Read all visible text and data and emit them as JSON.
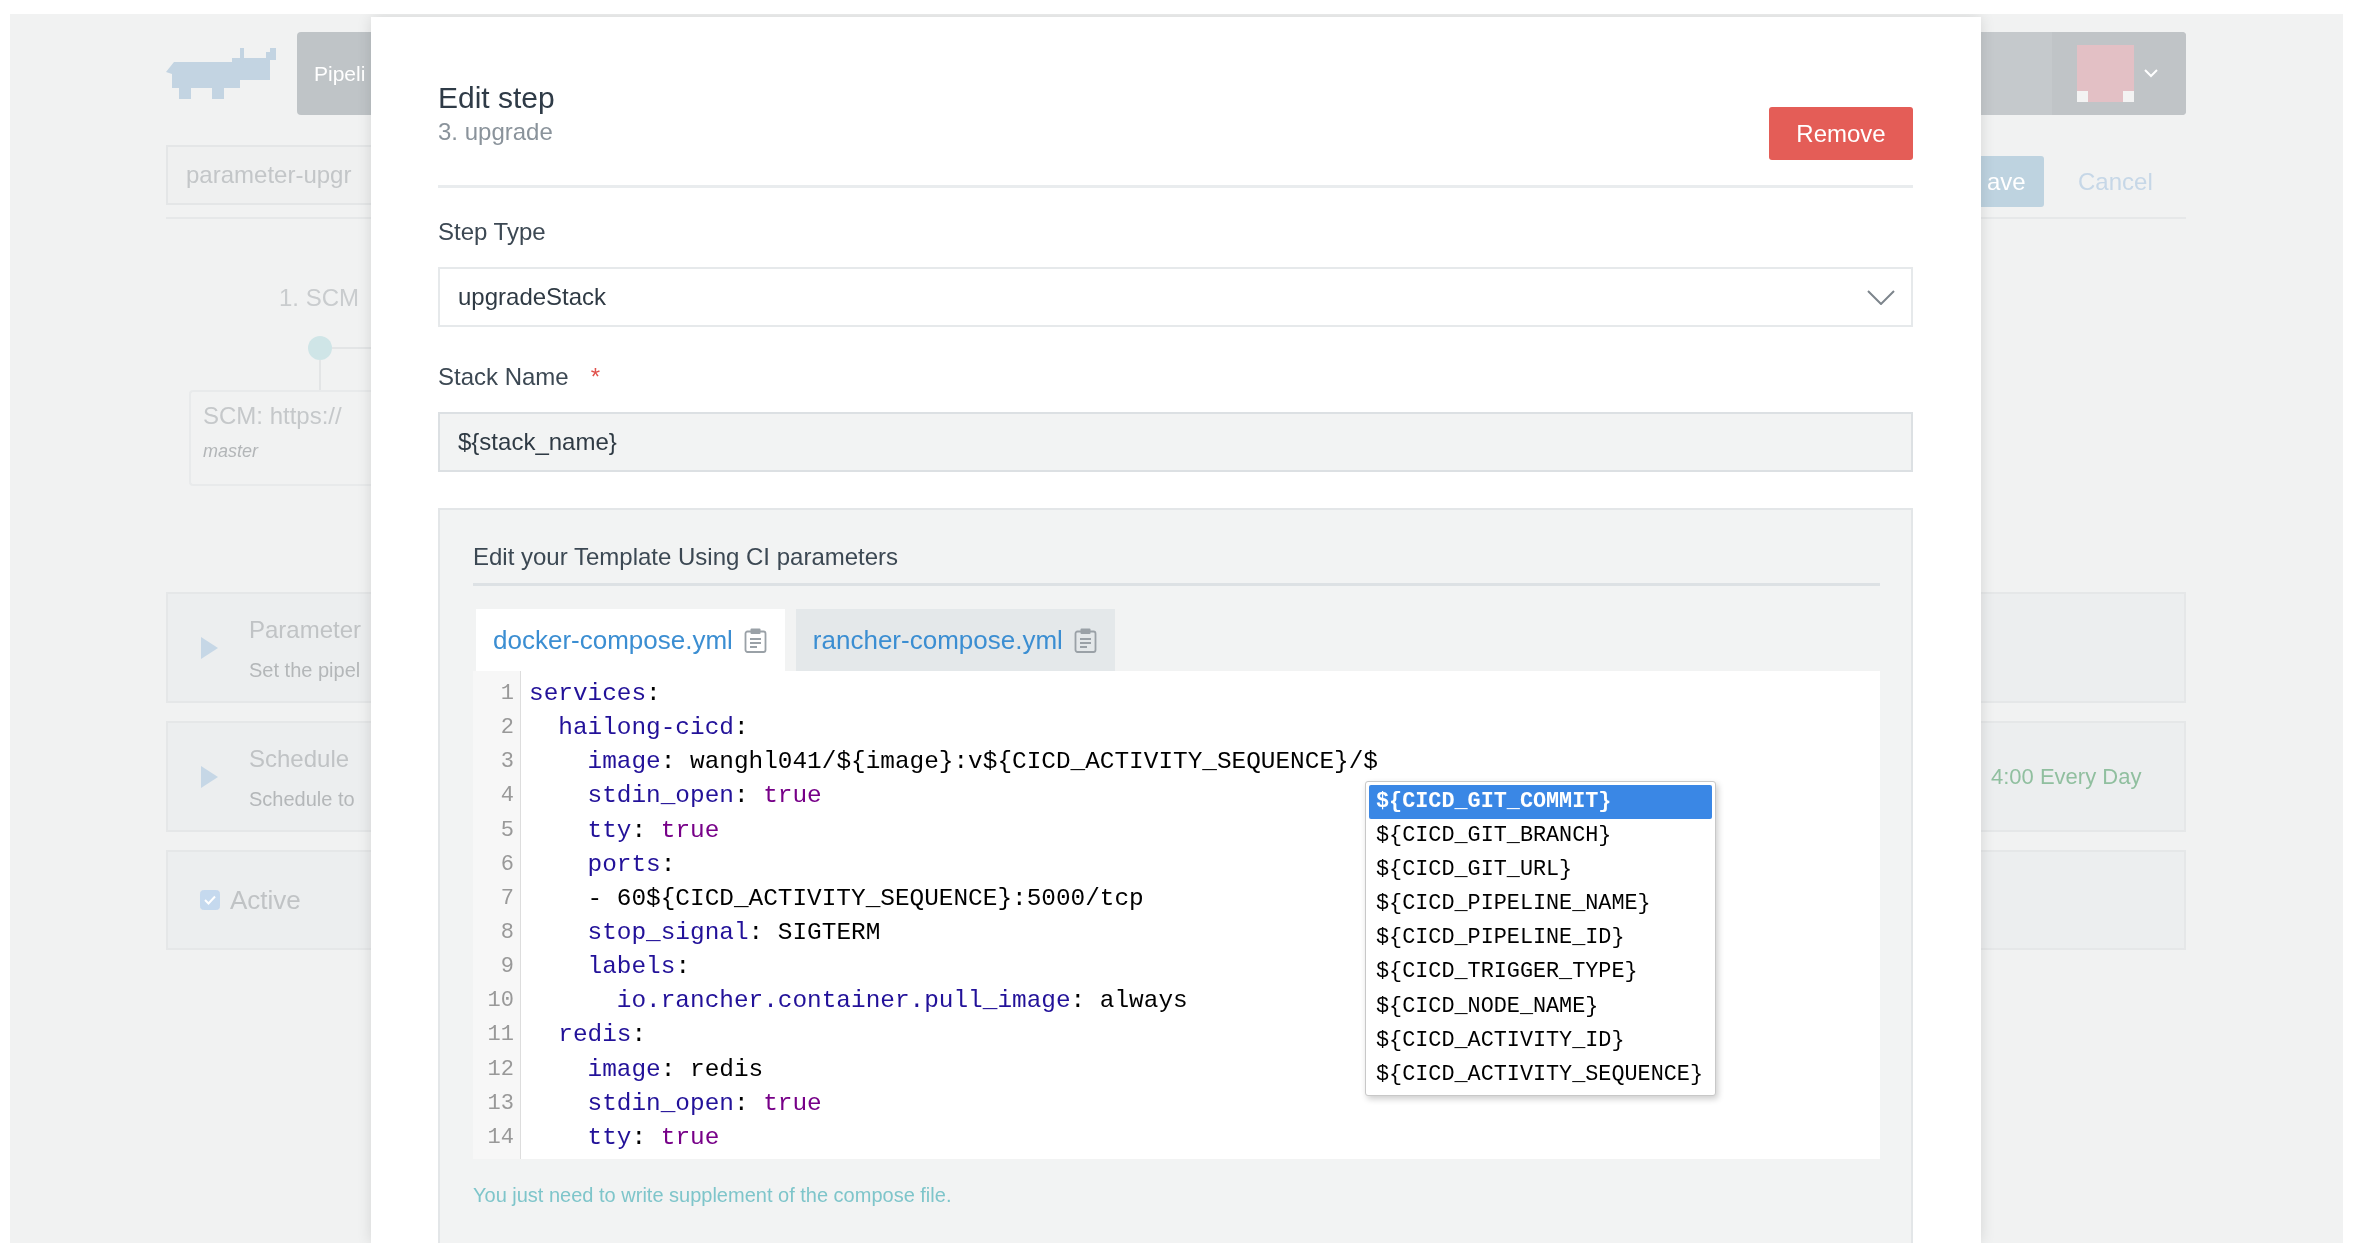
{
  "background": {
    "nav": {
      "tab": "Pipeli"
    },
    "pipeline_name": "parameter-upgr",
    "actions": [
      {
        "kind": "primary",
        "label": "ave"
      },
      {
        "kind": "link",
        "label": "Cancel"
      }
    ],
    "stage": {
      "title": "1. SCM",
      "card_title": "SCM: https://",
      "card_subtitle": "master"
    },
    "panels": [
      {
        "kind": "expander",
        "title": "Parameter",
        "description": "Set the pipel",
        "expanded": false
      },
      {
        "kind": "expander",
        "title": "Schedule",
        "description": "Schedule to",
        "summary": "4:00 Every Day",
        "expanded": false
      },
      {
        "kind": "checkbox",
        "label": "Active",
        "checked": true
      }
    ]
  },
  "modal": {
    "title": "Edit step",
    "subtitle": "3. upgrade",
    "remove_button": "Remove",
    "fields": [
      {
        "kind": "select",
        "label": "Step Type",
        "value": "upgradeStack"
      },
      {
        "kind": "input",
        "label": "Stack Name",
        "required_mark": "*",
        "value": "${stack_name}"
      }
    ],
    "template": {
      "title": "Edit your Template Using CI parameters",
      "tabs": [
        {
          "label": "docker-compose.yml",
          "selected": true
        },
        {
          "label": "rancher-compose.yml",
          "selected": false
        }
      ],
      "code_lines": [
        {
          "number": "1",
          "tokens": [
            {
              "kind": "key",
              "text": "services"
            },
            {
              "kind": "plain",
              "text": ":"
            }
          ]
        },
        {
          "number": "2",
          "tokens": [
            {
              "kind": "key",
              "text": "  hailong-cicd"
            },
            {
              "kind": "plain",
              "text": ":"
            }
          ]
        },
        {
          "number": "3",
          "tokens": [
            {
              "kind": "key",
              "text": "    image"
            },
            {
              "kind": "plain",
              "text": ": wanghl041/${image}:v${CICD_ACTIVITY_SEQUENCE}/$"
            }
          ]
        },
        {
          "number": "4",
          "tokens": [
            {
              "kind": "key",
              "text": "    stdin_open"
            },
            {
              "kind": "plain",
              "text": ": "
            },
            {
              "kind": "keyword",
              "text": "true"
            }
          ]
        },
        {
          "number": "5",
          "tokens": [
            {
              "kind": "key",
              "text": "    tty"
            },
            {
              "kind": "plain",
              "text": ": "
            },
            {
              "kind": "keyword",
              "text": "true"
            }
          ]
        },
        {
          "number": "6",
          "tokens": [
            {
              "kind": "key",
              "text": "    ports"
            },
            {
              "kind": "plain",
              "text": ":"
            }
          ]
        },
        {
          "number": "7",
          "tokens": [
            {
              "kind": "plain",
              "text": "    - 60${CICD_ACTIVITY_SEQUENCE}:5000/tcp"
            }
          ]
        },
        {
          "number": "8",
          "tokens": [
            {
              "kind": "key",
              "text": "    stop_signal"
            },
            {
              "kind": "plain",
              "text": ": SIGTERM"
            }
          ]
        },
        {
          "number": "9",
          "tokens": [
            {
              "kind": "key",
              "text": "    labels"
            },
            {
              "kind": "plain",
              "text": ":"
            }
          ]
        },
        {
          "number": "10",
          "tokens": [
            {
              "kind": "key",
              "text": "      io.rancher.container.pull_image"
            },
            {
              "kind": "plain",
              "text": ": always"
            }
          ]
        },
        {
          "number": "11",
          "tokens": [
            {
              "kind": "key",
              "text": "  redis"
            },
            {
              "kind": "plain",
              "text": ":"
            }
          ]
        },
        {
          "number": "12",
          "tokens": [
            {
              "kind": "key",
              "text": "    image"
            },
            {
              "kind": "plain",
              "text": ": redis"
            }
          ]
        },
        {
          "number": "13",
          "tokens": [
            {
              "kind": "key",
              "text": "    stdin_open"
            },
            {
              "kind": "plain",
              "text": ": "
            },
            {
              "kind": "keyword",
              "text": "true"
            }
          ]
        },
        {
          "number": "14",
          "tokens": [
            {
              "kind": "key",
              "text": "    tty"
            },
            {
              "kind": "plain",
              "text": ": "
            },
            {
              "kind": "keyword",
              "text": "true"
            }
          ]
        }
      ],
      "autocomplete": [
        {
          "text": "${CICD_GIT_COMMIT}",
          "selected": true
        },
        {
          "text": "${CICD_GIT_BRANCH}",
          "selected": false
        },
        {
          "text": "${CICD_GIT_URL}",
          "selected": false
        },
        {
          "text": "${CICD_PIPELINE_NAME}",
          "selected": false
        },
        {
          "text": "${CICD_PIPELINE_ID}",
          "selected": false
        },
        {
          "text": "${CICD_TRIGGER_TYPE}",
          "selected": false
        },
        {
          "text": "${CICD_NODE_NAME}",
          "selected": false
        },
        {
          "text": "${CICD_ACTIVITY_ID}",
          "selected": false
        },
        {
          "text": "${CICD_ACTIVITY_SEQUENCE}",
          "selected": false
        }
      ],
      "hint": "You just need to write supplement of the compose file."
    }
  }
}
